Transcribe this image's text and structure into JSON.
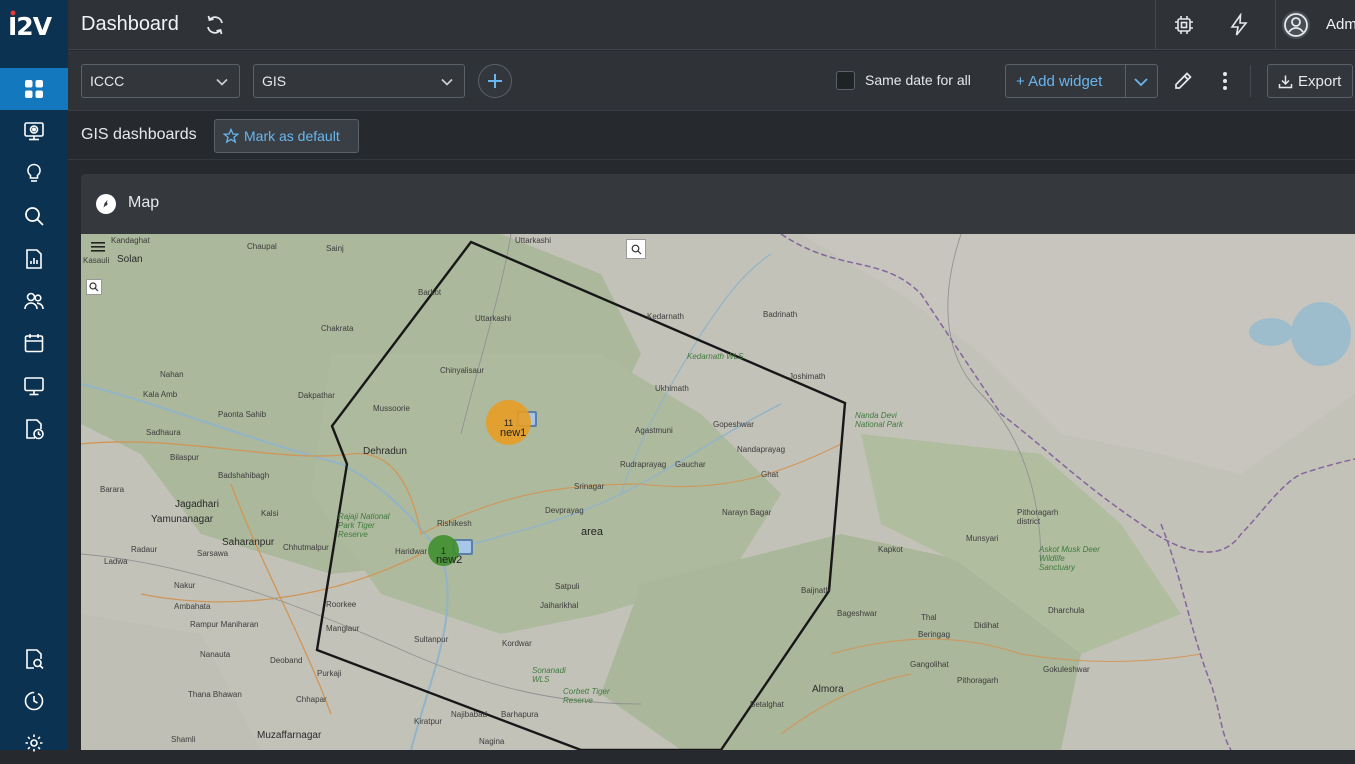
{
  "app": {
    "logo_text": "I2V"
  },
  "sidebar": {
    "items": [
      {
        "icon": "grid-icon",
        "active": true
      },
      {
        "icon": "camera-monitor-icon"
      },
      {
        "icon": "lightbulb-icon"
      },
      {
        "icon": "search-icon"
      },
      {
        "icon": "report-icon"
      },
      {
        "icon": "users-icon"
      },
      {
        "icon": "calendar-icon"
      },
      {
        "icon": "monitor-icon"
      },
      {
        "icon": "schedule-report-icon"
      },
      {
        "icon": "search-report-icon"
      },
      {
        "icon": "history-icon"
      },
      {
        "icon": "settings-icon"
      }
    ]
  },
  "header": {
    "title": "Dashboard",
    "user_name": "Adm"
  },
  "toolbar": {
    "select1_value": "ICCC",
    "select2_value": "GIS",
    "same_date_label": "Same date for all",
    "add_widget_label": "+ Add widget",
    "export_label": "Export"
  },
  "subbar": {
    "title": "GIS dashboards",
    "mark_default_label": "Mark as default"
  },
  "widget": {
    "title": "Map",
    "markers": [
      {
        "label": "new1",
        "count": "11",
        "color": "#e79d25"
      },
      {
        "label": "new2",
        "count": "1",
        "color": "#3f8f2e"
      }
    ],
    "polygon_label": "area",
    "places": [
      "Kandaghat",
      "Chaupal",
      "Sainj",
      "Uttarkashi",
      "Solan",
      "Kasauli",
      "Barkot",
      "Uttarkashi",
      "Chakrata",
      "Kedarnath",
      "Badrinath",
      "Nahan",
      "Chinyalisaur",
      "Joshimath",
      "Kala Amb",
      "Dakpathar",
      "Paonta Sahib",
      "Mussoorie",
      "Ukhimath",
      "Kedarnath WLS",
      "Nanda Devi National Park",
      "Sadhaura",
      "Dehradun",
      "Agastmuni",
      "Gopeshwar",
      "Bilaspur",
      "Badshahibagh",
      "Rudraprayag",
      "Gauchar",
      "Nandaprayag",
      "Ghat",
      "Barara",
      "Jagadhari",
      "Kalsi",
      "Srinagar",
      "Pithoragarh district",
      "Yamunanagar",
      "Rajaji National Park Tiger Reserve",
      "Rishikesh",
      "Devprayag",
      "Narayn Bagar",
      "Radaur",
      "Chhutmalpur",
      "Munsyari",
      "Askot Musk Deer Wildlife Sanctuary",
      "Ladwa",
      "Sarsawa",
      "Saharanpur",
      "Haridwar",
      "Satpuli",
      "Kapkot",
      "Nakur",
      "Roorkee",
      "Jaiharikhal",
      "Baijnath",
      "Dharchula",
      "Ambahata",
      "Rampur Maniharan",
      "Manglaur",
      "Bageshwar",
      "Thal",
      "Didihat",
      "Sultanpur",
      "Kordwar",
      "Beringag",
      "Nanauta",
      "Deoband",
      "Purkaji",
      "Sonanadi WLS",
      "Gangolihat",
      "Gokuleshwar",
      "Corbett Tiger Reserve",
      "Thana Bhawan",
      "Chhapar",
      "Almora",
      "Pithoragarh",
      "Najibabad",
      "Betalghat",
      "Kiratpur",
      "Barhapura",
      "Shamli",
      "Muzaffarnagar",
      "Nagina"
    ]
  }
}
